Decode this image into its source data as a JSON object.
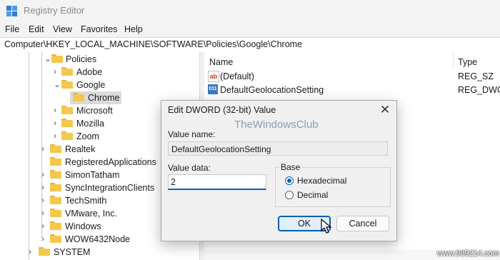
{
  "window": {
    "title": "Registry Editor"
  },
  "menu": [
    "File",
    "Edit",
    "View",
    "Favorites",
    "Help"
  ],
  "address": "Computer\\HKEY_LOCAL_MACHINE\\SOFTWARE\\Policies\\Google\\Chrome",
  "tree": {
    "items": [
      {
        "label": "Policies",
        "chevron": "⌄"
      },
      {
        "label": "Adobe",
        "chevron": "›"
      },
      {
        "label": "Google",
        "chevron": "⌄"
      },
      {
        "label": "Chrome",
        "chevron": ""
      },
      {
        "label": "Microsoft",
        "chevron": "›"
      },
      {
        "label": "Mozilla",
        "chevron": "›"
      },
      {
        "label": "Zoom",
        "chevron": "›"
      },
      {
        "label": "Realtek",
        "chevron": "›"
      },
      {
        "label": "RegisteredApplications",
        "chevron": ""
      },
      {
        "label": "SimonTatham",
        "chevron": "›"
      },
      {
        "label": "SyncIntegrationClients",
        "chevron": "›"
      },
      {
        "label": "TechSmith",
        "chevron": "›"
      },
      {
        "label": "VMware, Inc.",
        "chevron": "›"
      },
      {
        "label": "Windows",
        "chevron": "›"
      },
      {
        "label": "WOW6432Node",
        "chevron": "›"
      },
      {
        "label": "SYSTEM",
        "chevron": "›"
      }
    ]
  },
  "values": {
    "headers": {
      "name": "Name",
      "type": "Type"
    },
    "rows": [
      {
        "name": "(Default)",
        "type": "REG_SZ",
        "icon": "ab"
      },
      {
        "name": "DefaultGeolocationSetting",
        "type": "REG_DWORD",
        "icon": "011"
      }
    ]
  },
  "dialog": {
    "title": "Edit DWORD (32-bit) Value",
    "value_name_label": "Value name:",
    "value_name": "DefaultGeolocationSetting",
    "value_data_label": "Value data:",
    "value_data": "2",
    "base_label": "Base",
    "base_options": [
      {
        "label": "Hexadecimal",
        "selected": true
      },
      {
        "label": "Decimal",
        "selected": false
      }
    ],
    "ok_label": "OK",
    "cancel_label": "Cancel"
  },
  "watermarks": {
    "brand": "TheWindowsClub",
    "site": "www.989214.com"
  },
  "colors": {
    "accent": "#005fb8",
    "folder": "#f4c84c"
  }
}
